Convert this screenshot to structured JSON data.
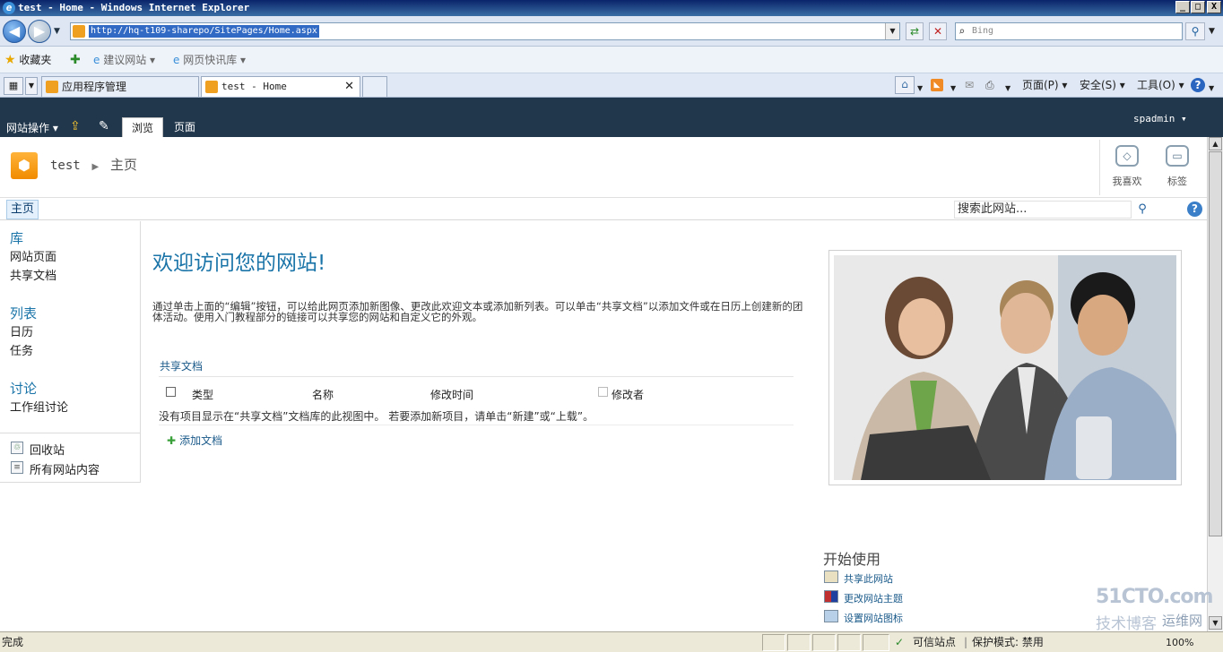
{
  "window": {
    "title": "test - Home - Windows Internet Explorer",
    "minimize": "_",
    "maximize": "□",
    "close": "X"
  },
  "address_bar": {
    "url": "http://hq-t109-sharepo/SitePages/Home.aspx",
    "search_placeholder": "Bing",
    "back_glyph": "◀",
    "forward_glyph": "▶"
  },
  "favorites_bar": {
    "favorites_label": "收藏夹",
    "items": [
      "建议网站 ▾",
      "网页快讯库 ▾"
    ]
  },
  "tabs": [
    {
      "label": "应用程序管理",
      "active": false
    },
    {
      "label": "test - Home",
      "active": true
    }
  ],
  "command_bar": {
    "page_menu": "页面(P) ▾",
    "safety_menu": "安全(S) ▾",
    "tools_menu": "工具(O) ▾",
    "help": "?"
  },
  "ribbon": {
    "site_actions": "网站操作 ▾",
    "tabs": [
      "浏览",
      "页面"
    ],
    "user": "spadmin ▾"
  },
  "site_header": {
    "site_name": "test",
    "current_page": "主页",
    "buttons": [
      "我喜欢",
      "标签"
    ]
  },
  "top_nav": {
    "home": "主页",
    "search_placeholder": "搜索此网站...",
    "help": "?"
  },
  "quick_launch": {
    "sections": [
      {
        "heading": "库",
        "items": [
          "网站页面",
          "共享文档"
        ]
      },
      {
        "heading": "列表",
        "items": [
          "日历",
          "任务"
        ]
      },
      {
        "heading": "讨论",
        "items": [
          "工作组讨论"
        ]
      }
    ],
    "footer": [
      "回收站",
      "所有网站内容"
    ]
  },
  "main": {
    "welcome": "欢迎访问您的网站!",
    "intro": "通过单击上面的“编辑”按钮，可以给此网页添加新图像、更改此欢迎文本或添加新列表。可以单击“共享文档”以添加文件或在日历上创建新的团体活动。使用入门教程部分的链接可以共享您的网站和自定义它的外观。",
    "doc_library": {
      "title": "共享文档",
      "columns": [
        "类型",
        "名称",
        "修改时间",
        "修改者"
      ],
      "empty_message": "没有项目显示在“共享文档”文档库的此视图中。 若要添加新项目，请单击“新建”或“上载”。",
      "add_label": "添加文档"
    }
  },
  "getting_started": {
    "title": "开始使用",
    "items": [
      "共享此网站",
      "更改网站主题",
      "设置网站图标"
    ]
  },
  "status_bar": {
    "status": "完成",
    "zone": "可信站点",
    "protected_mode": "保护模式: 禁用",
    "zoom": "100%"
  },
  "watermark": {
    "line1": "51CTO.com",
    "line2": "技术博客",
    "line3": "运维网"
  },
  "colors": {
    "ribbon_bg": "#21374c",
    "link_blue": "#1a74a8",
    "site_icon": "#f18b00"
  }
}
